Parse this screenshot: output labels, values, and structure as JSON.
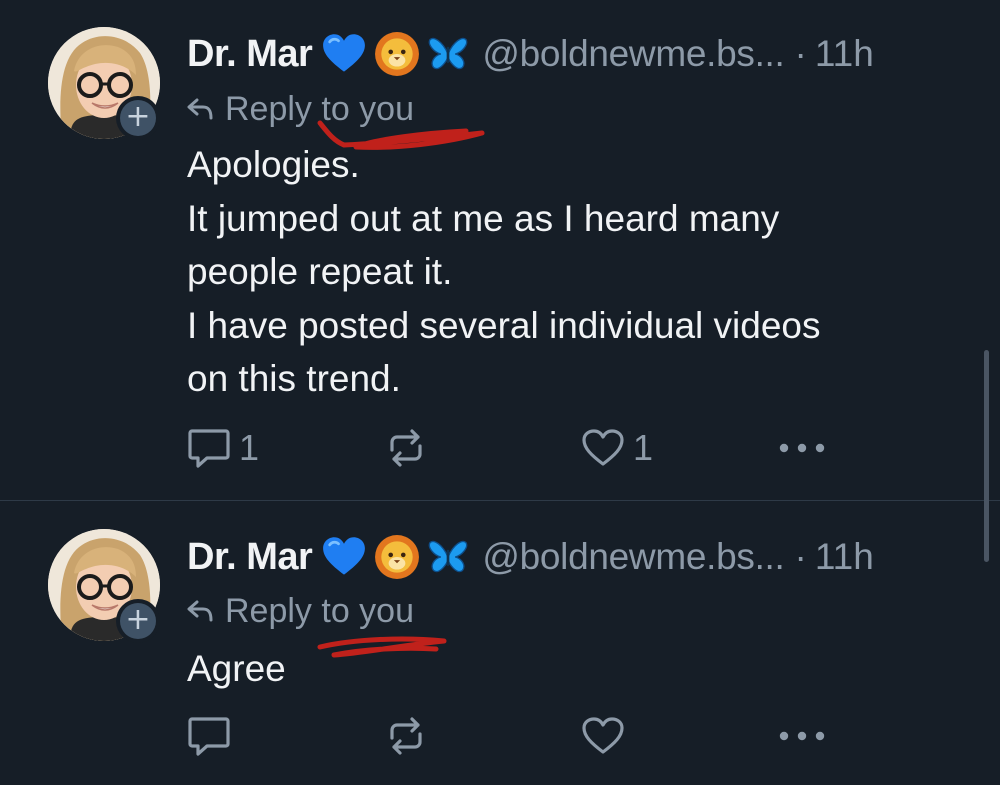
{
  "posts": [
    {
      "author": {
        "display_name": "Dr. Mar",
        "emojis": [
          "blue-heart",
          "lion-face",
          "butterfly"
        ],
        "handle": "@boldnewme.bs...",
        "separator": "·",
        "time": "11h"
      },
      "reply_context": "Reply to you",
      "text": "Apologies.\nIt jumped out at me as I heard many\npeople repeat it.\nI have posted several individual videos\non this trend.",
      "actions": {
        "reply_count": "1",
        "repost_count": "",
        "like_count": "1"
      }
    },
    {
      "author": {
        "display_name": "Dr. Mar",
        "emojis": [
          "blue-heart",
          "lion-face",
          "butterfly"
        ],
        "handle": "@boldnewme.bs...",
        "separator": "·",
        "time": "11h"
      },
      "reply_context": "Reply to you",
      "text": "Agree",
      "actions": {
        "reply_count": "",
        "repost_count": "",
        "like_count": ""
      }
    }
  ],
  "icons": [
    "plus-icon",
    "reply-arrow-icon",
    "reply-icon",
    "repost-icon",
    "like-icon",
    "more-icon"
  ],
  "colors": {
    "background": "#161e27",
    "text": "#f1f3f5",
    "muted": "#8d9aa8",
    "annotation": "#c0211b",
    "divider": "#2e3a47"
  }
}
